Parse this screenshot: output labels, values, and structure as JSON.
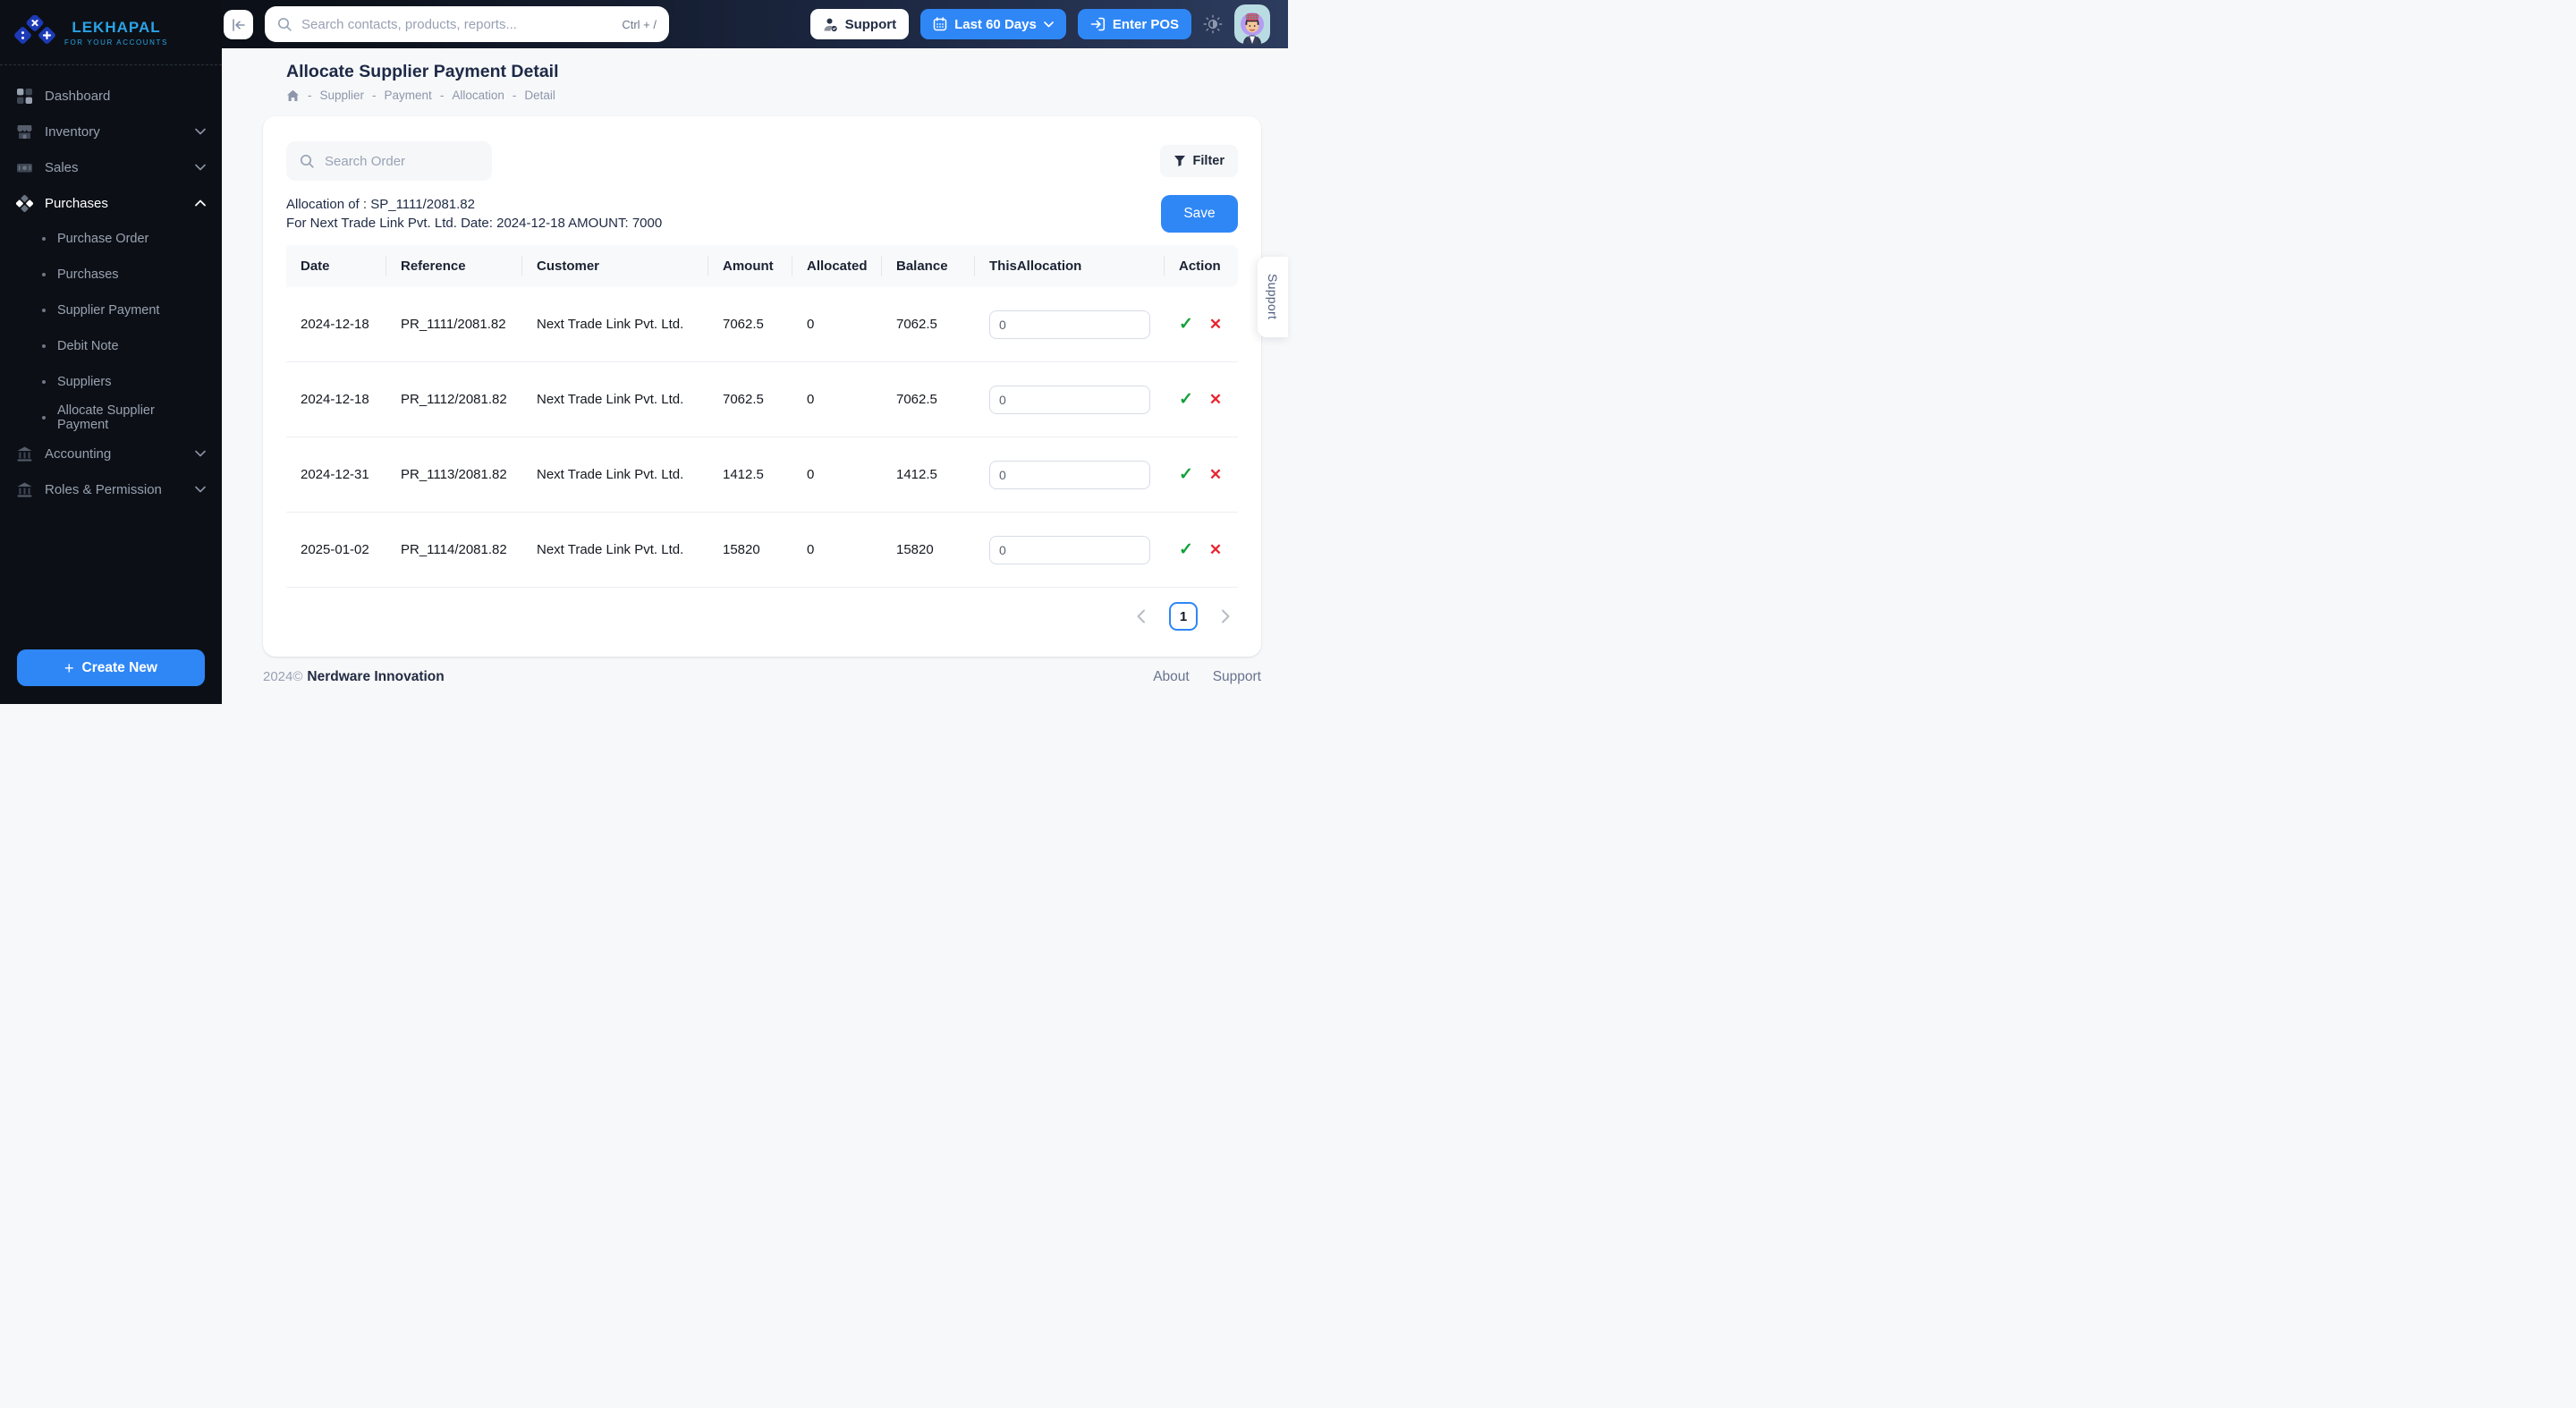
{
  "brand": {
    "name": "LEKHAPAL",
    "tagline": "FOR YOUR ACCOUNTS"
  },
  "header": {
    "search_placeholder": "Search contacts, products, reports...",
    "search_shortcut": "Ctrl + /",
    "support_label": "Support",
    "date_range_label": "Last 60 Days",
    "enter_pos_label": "Enter POS"
  },
  "sidebar": {
    "items": [
      {
        "label": "Dashboard"
      },
      {
        "label": "Inventory"
      },
      {
        "label": "Sales"
      },
      {
        "label": "Purchases"
      },
      {
        "label": "Accounting"
      },
      {
        "label": "Roles & Permission"
      }
    ],
    "purchases_submenu": [
      "Purchase Order",
      "Purchases",
      "Supplier Payment",
      "Debit Note",
      "Suppliers",
      "Allocate Supplier Payment"
    ],
    "create_new_label": "Create New"
  },
  "page": {
    "title": "Allocate Supplier Payment Detail",
    "breadcrumb": [
      "Supplier",
      "Payment",
      "Allocation",
      "Detail"
    ],
    "breadcrumb_separator": "-"
  },
  "panel": {
    "search_placeholder": "Search Order",
    "filter_label": "Filter",
    "allocation_line1": "Allocation of : SP_1111/2081.82",
    "allocation_line2": "For Next Trade Link Pvt. Ltd. Date: 2024-12-18 AMOUNT: 7000",
    "save_label": "Save"
  },
  "table": {
    "columns": [
      "Date",
      "Reference",
      "Customer",
      "Amount",
      "Allocated",
      "Balance",
      "ThisAllocation",
      "Action"
    ],
    "rows": [
      {
        "date": "2024-12-18",
        "reference": "PR_1111/2081.82",
        "customer": "Next Trade Link Pvt. Ltd.",
        "amount": "7062.5",
        "allocated": "0",
        "balance": "7062.5",
        "this_allocation": "0"
      },
      {
        "date": "2024-12-18",
        "reference": "PR_1112/2081.82",
        "customer": "Next Trade Link Pvt. Ltd.",
        "amount": "7062.5",
        "allocated": "0",
        "balance": "7062.5",
        "this_allocation": "0"
      },
      {
        "date": "2024-12-31",
        "reference": "PR_1113/2081.82",
        "customer": "Next Trade Link Pvt. Ltd.",
        "amount": "1412.5",
        "allocated": "0",
        "balance": "1412.5",
        "this_allocation": "0"
      },
      {
        "date": "2025-01-02",
        "reference": "PR_1114/2081.82",
        "customer": "Next Trade Link Pvt. Ltd.",
        "amount": "15820",
        "allocated": "0",
        "balance": "15820",
        "this_allocation": "0"
      }
    ]
  },
  "pagination": {
    "current_page": "1"
  },
  "footer": {
    "year": "2024©",
    "company": "Nerdware Innovation",
    "links": [
      "About",
      "Support"
    ]
  },
  "side_tab": {
    "label": "Support"
  },
  "icons": {
    "plus": "+",
    "check": "✓",
    "cross": "✕"
  },
  "colors": {
    "accent": "#2f87f6",
    "brand_blue": "#2aa3e6",
    "success": "#12a13a",
    "danger": "#e72530"
  }
}
